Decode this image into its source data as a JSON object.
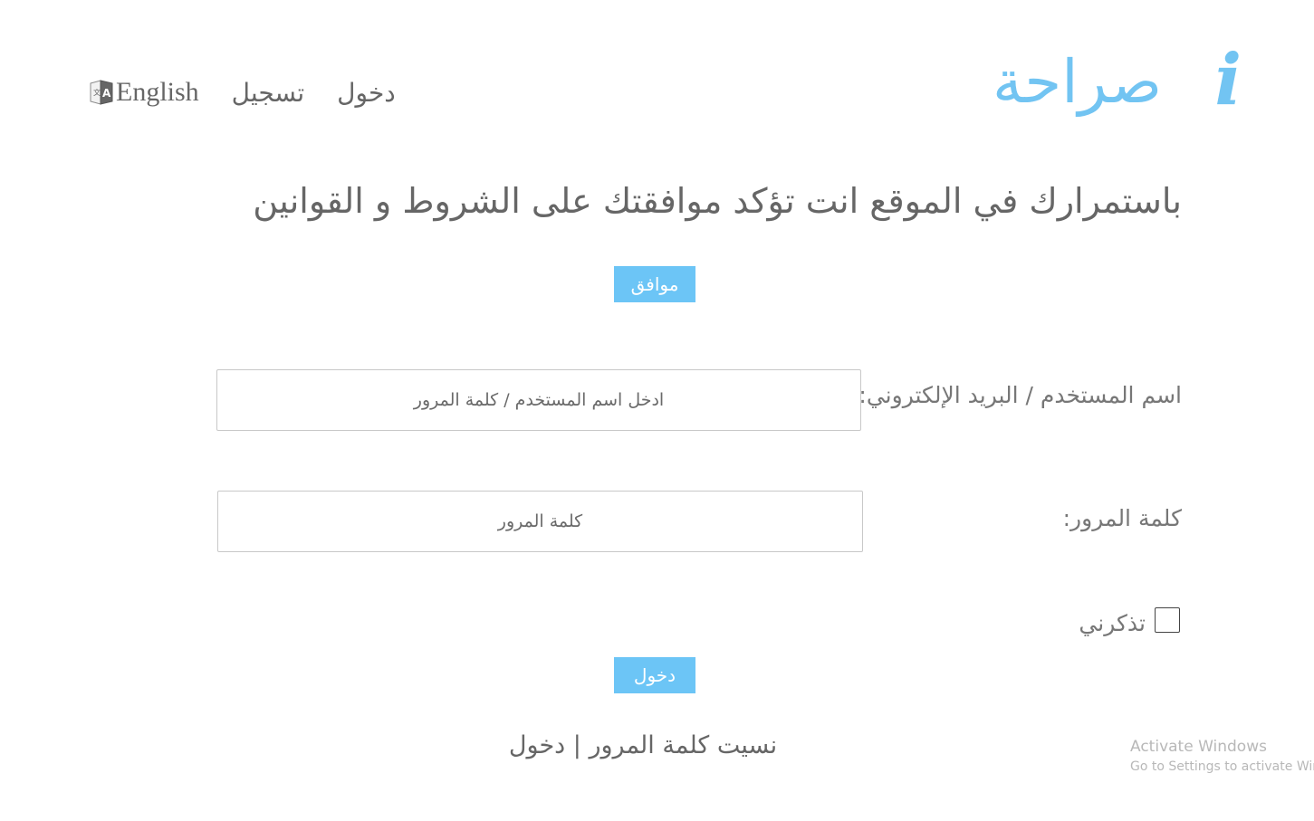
{
  "header": {
    "logo_text": "صراحة",
    "logo_letter": "i",
    "nav": {
      "language_label": "English",
      "register_label": "تسجيل",
      "login_label": "دخول"
    }
  },
  "terms": {
    "notice": "باستمرارك في الموقع انت تؤكد موافقتك على الشروط و القوانين",
    "agree_button": "موافق"
  },
  "form": {
    "username_label": "اسم المستخدم / البريد الإلكتروني:",
    "username_placeholder": "ادخل اسم المستخدم / كلمة المرور",
    "password_label": "كلمة المرور:",
    "password_placeholder": "كلمة المرور",
    "remember_label": "تذكرني",
    "remember_checked": false,
    "submit_button": "دخول"
  },
  "footer": {
    "forgot_password": "نسيت كلمة المرور",
    "separator": "|",
    "login_link": "دخول"
  },
  "watermark": {
    "title": "Activate Windows",
    "subtitle": "Go to Settings to activate Windows."
  },
  "colors": {
    "accent": "#6cc5f6",
    "logo": "#72c4f2",
    "text": "#666666"
  }
}
